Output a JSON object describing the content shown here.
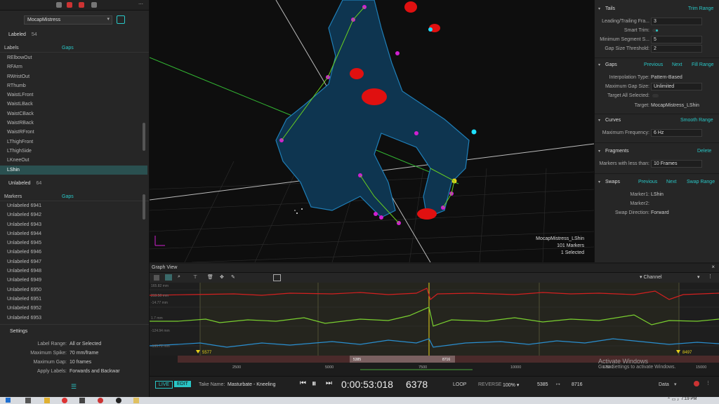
{
  "left": {
    "take_dropdown": "MocapMistress",
    "labeled_title": "Labeled",
    "labeled_count": "54",
    "labels_col": "Labels",
    "gaps_col": "Gaps",
    "labeled_items": [
      "RElbowOut",
      "RFArm",
      "RWristOut",
      "RThumb",
      "WaistLFront",
      "WaistLBack",
      "WaistCBack",
      "WaistRBack",
      "WaistRFront",
      "LThighFront",
      "LThighSide",
      "LKneeOut",
      "LShin"
    ],
    "selected_index": 12,
    "unlabeled_title": "Unlabeled",
    "unlabeled_count": "64",
    "markers_col": "Markers",
    "unlabeled_gaps_col": "Gaps",
    "unlabeled_items": [
      "Unlabeled 6941",
      "Unlabeled 6942",
      "Unlabeled 6943",
      "Unlabeled 6944",
      "Unlabeled 6945",
      "Unlabeled 6946",
      "Unlabeled 6947",
      "Unlabeled 6948",
      "Unlabeled 6949",
      "Unlabeled 6950",
      "Unlabeled 6951",
      "Unlabeled 6952",
      "Unlabeled 6953"
    ],
    "settings_title": "Settings",
    "settings": [
      {
        "label": "Label Range:",
        "value": "All or Selected"
      },
      {
        "label": "Maximum Spike:",
        "value": "70 mm/frame"
      },
      {
        "label": "Maximum Gap:",
        "value": "10 frames"
      },
      {
        "label": "Apply Labels:",
        "value": "Forwards and Backwar"
      }
    ]
  },
  "viewport": {
    "info_name": "MocapMistress_LShin",
    "info_markers": "101 Markers",
    "info_selected": "1 Selected"
  },
  "right": {
    "tails_title": "Tails",
    "tails_action": "Trim Range",
    "tails_rows": [
      {
        "label": "Leading/Trailing Fra...",
        "value": "3"
      },
      {
        "label": "Smart Trim:",
        "value": ""
      },
      {
        "label": "Minimum Segment S...",
        "value": "5"
      },
      {
        "label": "Gap Size Threshold:",
        "value": "2"
      }
    ],
    "gaps_title": "Gaps",
    "gaps_prev": "Previous",
    "gaps_next": "Next",
    "gaps_fill": "Fill Range",
    "gaps_rows": [
      {
        "label": "Interpolation Type:",
        "value": "Pattern-Based"
      },
      {
        "label": "Maximum Gap Size:",
        "value": "Unlimited"
      },
      {
        "label": "Target All Selected:",
        "value": ""
      },
      {
        "label": "Target:",
        "value": "MocapMistress_LShin"
      }
    ],
    "curves_title": "Curves",
    "curves_action": "Smooth Range",
    "curves_label": "Maximum Frequency:",
    "curves_value": "6 Hz",
    "fragments_title": "Fragments",
    "fragments_action": "Delete",
    "fragments_label": "Markers with less than:",
    "fragments_value": "10 Frames",
    "swaps_title": "Swaps",
    "swaps_prev": "Previous",
    "swaps_next": "Next",
    "swaps_action": "Swap Range",
    "swaps_rows": [
      {
        "label": "Marker1:",
        "value": "LShin"
      },
      {
        "label": "Marker2:",
        "value": ""
      },
      {
        "label": "Swap Direction:",
        "value": "Forward"
      }
    ]
  },
  "graph": {
    "title": "Graph View",
    "channel": "Channel",
    "y_labels": [
      "165.82 mm",
      "219.50 mm",
      "-14.77 mm",
      "1.7 mm",
      "-124.94 mm",
      "-195.72 mm"
    ],
    "marker_left": "5577",
    "marker_right": "8497",
    "range_left": "5385",
    "range_right": "8716",
    "ticks": [
      "2500",
      "5000",
      "7500",
      "10000",
      "12500",
      "15000"
    ]
  },
  "bottom": {
    "live": "LIVE",
    "edit": "EDIT",
    "take_label": "Take Name:",
    "take_name": "Masturbate - Kneeling",
    "timecode": "0:00:53:018",
    "frame": "6378",
    "loop": "LOOP",
    "reverse": "REVERSE",
    "speed": "100%",
    "start": "5385",
    "end": "8716",
    "data": "Data"
  },
  "watermark": {
    "line1": "Activate Windows",
    "line2": "Go to Settings to activate Windows."
  },
  "taskbar": {
    "time": "7:19 PM"
  },
  "colors": {
    "accent": "#29c7c7",
    "red_curve": "#d42020",
    "green_curve": "#7ad030",
    "blue_curve": "#2a8fd0",
    "marker_yellow": "#e6d21a"
  }
}
